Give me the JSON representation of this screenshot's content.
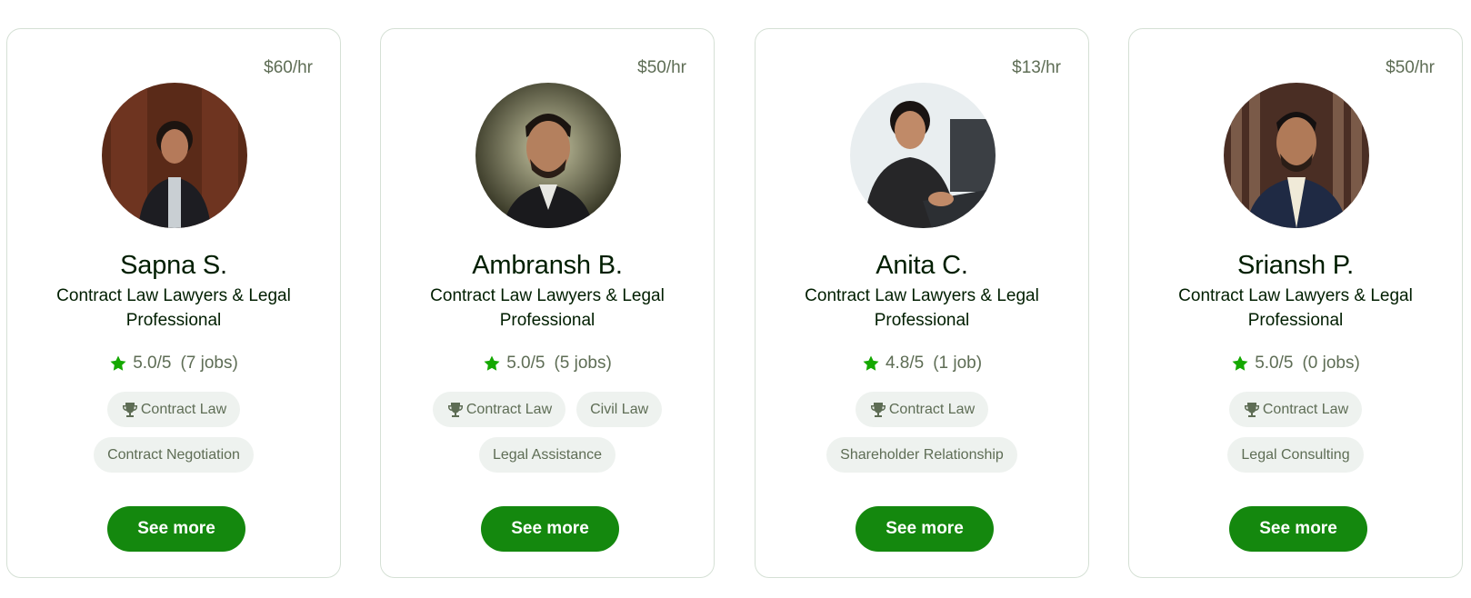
{
  "colors": {
    "accent": "#14880e",
    "star": "#14a800",
    "muted": "#5e6d55",
    "chip_bg": "#eef2ef",
    "border": "#d5e0d5"
  },
  "cards": [
    {
      "rate": "$60/hr",
      "name": "Sapna S.",
      "title": "Contract Law Lawyers & Legal Professional",
      "rating": "5.0/5",
      "jobs": "(7 jobs)",
      "top_skill": "Contract Law",
      "skills": [
        "Contract Negotiation"
      ],
      "button": "See more"
    },
    {
      "rate": "$50/hr",
      "name": "Ambransh B.",
      "title": "Contract Law Lawyers & Legal Professional",
      "rating": "5.0/5",
      "jobs": "(5 jobs)",
      "top_skill": "Contract Law",
      "skills": [
        "Civil Law",
        "Legal Assistance"
      ],
      "button": "See more"
    },
    {
      "rate": "$13/hr",
      "name": "Anita C.",
      "title": "Contract Law Lawyers & Legal Professional",
      "rating": "4.8/5",
      "jobs": "(1 job)",
      "top_skill": "Contract Law",
      "skills": [
        "Shareholder Relationship"
      ],
      "button": "See more"
    },
    {
      "rate": "$50/hr",
      "name": "Sriansh P.",
      "title": "Contract Law Lawyers & Legal Professional",
      "rating": "5.0/5",
      "jobs": "(0 jobs)",
      "top_skill": "Contract Law",
      "skills": [
        "Legal Consulting"
      ],
      "button": "See more"
    }
  ],
  "icons": {
    "rating": "star-icon",
    "top_skill": "trophy-icon"
  }
}
